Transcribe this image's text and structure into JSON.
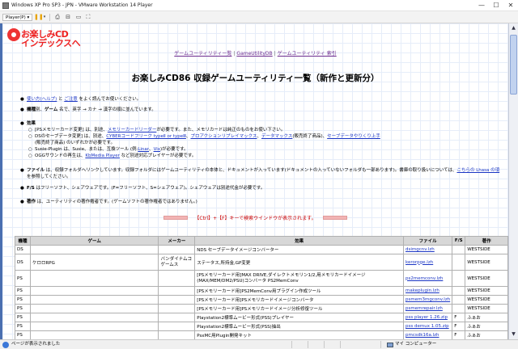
{
  "window": {
    "title": "Windows XP Pro SP3 - JPN - VMware Workstation 14 Player",
    "minimize_glyph": "—",
    "maximize_glyph": "☐",
    "close_glyph": "✕"
  },
  "toolbar": {
    "player_menu": "Player(P) ▾",
    "icons": [
      "pause-icon",
      "dropdown-icon",
      "send-ctrl-alt-del-icon",
      "usb-icon",
      "removable-devices-icon",
      "fullscreen-icon"
    ]
  },
  "page": {
    "logo_line1": "お楽しみCD",
    "logo_line2": "インデックスへ",
    "nav": [
      "ゲームユーティリティー覧",
      "GameUtilityDB",
      "ゲームユーティリティ 索引"
    ],
    "nav_sep": "|",
    "heading": "お楽しみCD86 収録ゲームユーティリティ一覧（新作と更新分）",
    "bullets": {
      "b1_link1": "使い方(ヘルプ)",
      "b1_mid": " と ",
      "b1_link2": "ご注意",
      "b1_tail": " をよく読んでお使いください。",
      "b2_bold1": "機種",
      "b2_mid1": "別、",
      "b2_bold2": "ゲーム",
      "b2_tail": " 名で、英字 → カナ → 漢字の順に並んでいます。",
      "b3_title": "効果",
      "b3_s1": "[PSメモリーカード変更] は、別途、",
      "b3_s1_link": "メモリーカードリーダー",
      "b3_s1_tail": "が必要です。また、メモリカードは純正のものをお使い下さい。",
      "b3_s2": "DSのセーブデータ変更] は、別途、",
      "b3_s2_link1": "CYBERコードフリーク typeⅡ or typeⅢ",
      "b3_s2_c1": "、",
      "b3_s2_link2": "プロアクションリプレイマックス",
      "b3_s2_c2": "、",
      "b3_s2_link3": "データマックス",
      "b3_s2_c3": "(販売終了商品)、",
      "b3_s2_link4": "セーブデータやりくり上手",
      "b3_s2_tail": "(販売終了商品) のいずれかが必要です。",
      "b3_s3": "Susie-Plugin は、Susie、または、互換ツール (例:",
      "b3_s3_link1": "Linar",
      "b3_s3_c": "、",
      "b3_s3_link2": "Vix",
      "b3_s3_tail": ")が必要です。",
      "b3_s4": "OGGサウンドの再生は、",
      "b3_s4_link": "KbMedia Player",
      "b3_s4_tail": " など別途対応プレイヤーが必要です。",
      "b4_bold": "ファイル",
      "b4_text": " は、収録フォルダへリンクしています。収録フォルダにはゲームユーティリティの本体と、ドキュメントが入っています(ドキュメントの入っていないフォルダも一部あります)。書庫の取り扱いについては、",
      "b4_link": "こちらの Lhasa の項",
      "b4_tail": " を参照してください。",
      "b5_bold": "F/S",
      "b5_text": " はフリーソフト、シェアウェアです。(F=フリーソフト、S=シェアウェア)。シェアウェアは別途代金が必要です。",
      "b6_bold": "著作",
      "b6_text": " は、ユーティリティの著作権者です。(ゲームソフトの著作権者ではありません。)"
    },
    "search_hint": "【Ctrl】+【F】キーで検索ウインドウが表示されます。"
  },
  "table": {
    "headers": [
      "機種",
      "ゲーム",
      "メーカー",
      "効果",
      "ファイル",
      "F/S",
      "著作"
    ],
    "rows": [
      [
        "DS",
        "",
        "",
        "NDS セーブデータイメージコンバーター",
        "dsimgcnv.lzh",
        "",
        "WESTSIDE"
      ],
      [
        "DS",
        "ケロロRPG",
        "バンダイナムコゲームス",
        "ステータス,所持金,GP変更",
        "kerorpge.lzh",
        "",
        "WESTSIDE"
      ],
      [
        "PS",
        "",
        "",
        "[PSメモリーカード用]MAX DRIVE,ダイレクトメモリン1/2,用メモリカードイメージ(MAX/MEM/DM2/PSU)コンバータ PS2MemConv",
        "ps2memconv.lzh",
        "",
        "WESTSIDE"
      ],
      [
        "PS",
        "",
        "",
        "[PSメモリーカード用]PS2MemConv用プラグイン作成ツール",
        "makeplugin.lzh",
        "",
        "WESTSIDE"
      ],
      [
        "PS",
        "",
        "",
        "[PSメモリーカード用]PSメモリカードイメージコンバータ",
        "psmem3mgconv.lzh",
        "",
        "WESTSIDE"
      ],
      [
        "PS",
        "",
        "",
        "[PSメモリーカード用]PSメモリカードイメージ分析修復ツール",
        "psmemrepair.lzh",
        "",
        "WESTSIDE"
      ],
      [
        "PS",
        "",
        "",
        "Playstation2標準ムービー形式(PSS)プレイヤー",
        "pss player 1.26.zip",
        "F",
        "ふぁお"
      ],
      [
        "PS",
        "",
        "",
        "Playstation2標準ムービー形式(PSS)抽出",
        "pss demux 1.05.zip",
        "F",
        "ふぁお"
      ],
      [
        "PS",
        "",
        "",
        "PsxMC用Plugin開発キット",
        "pmcsdk16a.lzh",
        "F",
        "ふぁお"
      ]
    ]
  },
  "status": {
    "left": "ページが表示されました",
    "zone": "マイ コンピューター"
  }
}
